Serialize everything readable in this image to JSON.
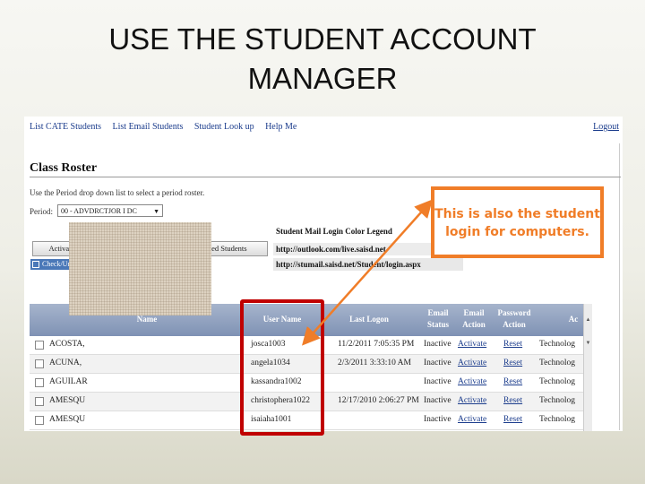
{
  "slide": {
    "title_line1": "USE THE STUDENT ACCOUNT",
    "title_line2": "MANAGER"
  },
  "nav": {
    "items": [
      "List CATE Students",
      "List Email Students",
      "Student Look up",
      "Help Me"
    ],
    "logout": "Logout"
  },
  "page": {
    "title": "Class Roster",
    "instructions": "Use the Period drop down list to select a period roster.",
    "period_label": "Period:",
    "period_value": "00 - ADVDRCTJOR I DC"
  },
  "buttons": {
    "activate_checked": "Activate Checked Students",
    "reset_checked": "Reset Checked Students",
    "check_all": "Check/Uncheck All"
  },
  "legend": {
    "title": "Student Mail Login Color Legend",
    "url1": "http://outlook.com/live.saisd.net",
    "url2": "http://stumail.saisd.net/Student/login.aspx"
  },
  "table": {
    "headers": {
      "name": "Name",
      "username": "User Name",
      "last_logon": "Last Logon",
      "email_status_1": "Email",
      "email_status_2": "Status",
      "email_action_1": "Email",
      "email_action_2": "Action",
      "password_action_1": "Password",
      "password_action_2": "Action",
      "last_col": "Ac"
    },
    "rows": [
      {
        "name": "ACOSTA,",
        "username": "josca1003",
        "logon": "11/2/2011 7:05:35 PM",
        "status": "Inactive",
        "action": "Activate",
        "password": "Reset",
        "extra": "Technolog"
      },
      {
        "name": "ACUNA,",
        "username": "angela1034",
        "logon": "2/3/2011 3:33:10 AM",
        "status": "Inactive",
        "action": "Activate",
        "password": "Reset",
        "extra": "Technolog"
      },
      {
        "name": "AGUILAR",
        "username": "kassandra1002",
        "logon": "",
        "status": "Inactive",
        "action": "Activate",
        "password": "Reset",
        "extra": "Technolog"
      },
      {
        "name": "AMESQU",
        "username": "christophera1022",
        "logon": "12/17/2010 2:06:27 PM",
        "status": "Inactive",
        "action": "Activate",
        "password": "Reset",
        "extra": "Technolog"
      },
      {
        "name": "AMESQU",
        "username": "isaiaha1001",
        "logon": "",
        "status": "Inactive",
        "action": "Activate",
        "password": "Reset",
        "extra": "Technolog"
      }
    ]
  },
  "callout": {
    "line1": "This is also the student",
    "line2": "login for computers."
  },
  "colors": {
    "callout": "#f07d28",
    "highlight": "#c00000",
    "link": "#1b3c8c",
    "header": "#8a9cbc"
  }
}
